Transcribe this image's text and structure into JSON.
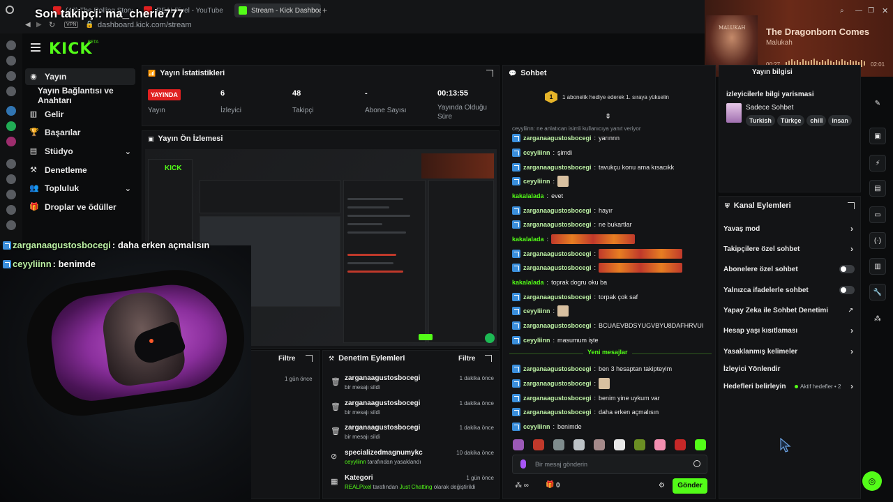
{
  "browser": {
    "tabs": [
      "(40) The Rolling Stones - ...",
      "REALPixel - YouTube",
      "Stream - Kick Dashboard"
    ],
    "url": "dashboard.kick.com/stream",
    "vpn": "VPN"
  },
  "overlay": {
    "last_follower": "Son takipçi: ma_cherie777",
    "chat1_user": "zarganaagustosbocegi",
    "chat1_text": ": daha erken açmalısın",
    "chat2_user": "ceyyliinn",
    "chat2_text": ": benimde"
  },
  "now_playing": {
    "title": "The Dragonborn Comes",
    "artist": "Malukah",
    "elapsed": "00:27",
    "remaining": "02:01",
    "art_label": "MALUKAH"
  },
  "brand": {
    "logo": "KICK",
    "beta": "BETA"
  },
  "nav": {
    "stream": "Yayın",
    "stream_key": "Yayın Bağlantısı ve Anahtarı",
    "income": "Gelir",
    "achievements": "Başarılar",
    "studio": "Stüdyo",
    "moderation": "Denetleme",
    "community": "Topluluk",
    "drops": "Droplar ve ödüller"
  },
  "stats": {
    "title": "Yayın İstatistikleri",
    "live_badge": "YAYINDA",
    "live_label": "Yayın",
    "viewers_value": "6",
    "viewers_label": "İzleyici",
    "followers_value": "48",
    "followers_label": "Takipçi",
    "subs_value": "-",
    "subs_label": "Abone Sayısı",
    "uptime_value": "00:13:55",
    "uptime_label": "Yayında Olduğu Süre"
  },
  "preview": {
    "title": "Yayın Ön İzlemesi"
  },
  "left_bottom": {
    "filter": "Filtre",
    "time": "1 gün önce"
  },
  "moderation": {
    "title": "Denetim Eylemleri",
    "filter": "Filtre",
    "rows": [
      {
        "user": "zarganaagustosbocegi",
        "desc": "bir mesajı sildi",
        "time": "1 dakika önce"
      },
      {
        "user": "zarganaagustosbocegi",
        "desc": "bir mesajı sildi",
        "time": "1 dakika önce"
      },
      {
        "user": "zarganaagustosbocegi",
        "desc": "bir mesajı sildi",
        "time": "1 dakika önce"
      },
      {
        "user": "specializedmagnumykc",
        "desc_user": "ceyyliinn",
        "desc": "tarafından yasaklandı",
        "time": "10 dakika önce"
      },
      {
        "user": "Kategori",
        "desc_user": "REALPixel",
        "desc": "tarafından",
        "desc_cat": "Just Chatting",
        "desc_end": "olarak değiştirildi",
        "time": "1 gün önce"
      }
    ]
  },
  "chat": {
    "title": "Sohbet",
    "gift_text": "1 abonelik hediye ederek 1. sıraya yükselin",
    "gift_rank": "1",
    "reply_hint": "ceyyliinn: ne anlatıcan isimli kullanıcıya yanıt veriyor",
    "messages": [
      {
        "user": "zarganaagustosbocegi",
        "text": "yarınnn"
      },
      {
        "user": "ceyyliinn",
        "text": "şimdi"
      },
      {
        "user": "zarganaagustosbocegi",
        "text": "tavukçu konu ama kısacıkk"
      },
      {
        "user": "ceyyliinn",
        "text": ""
      },
      {
        "user": "kakalalada",
        "text": "evet"
      },
      {
        "user": "zarganaagustosbocegi",
        "text": "hayır"
      },
      {
        "user": "zarganaagustosbocegi",
        "text": "ne bukartlar"
      },
      {
        "user": "kakalalada",
        "text": ""
      },
      {
        "user": "zarganaagustosbocegi",
        "text": ""
      },
      {
        "user": "zarganaagustosbocegi",
        "text": ""
      },
      {
        "user": "kakalalada",
        "text": "toprak dogru oku ba"
      },
      {
        "user": "zarganaagustosbocegi",
        "text": "torpak çok saf"
      },
      {
        "user": "ceyyliinn",
        "text": ""
      },
      {
        "user": "zarganaagustosbocegi",
        "text": "BCUAEVBDSYUGVBYU8DAFHRVUI"
      },
      {
        "user": "ceyyliinn",
        "text": "masumum işte"
      }
    ],
    "new_messages": "Yeni mesajlar",
    "new": [
      {
        "user": "zarganaagustosbocegi",
        "text": "ben 3 hesaptan takipteyim"
      },
      {
        "user": "zarganaagustosbocegi",
        "text": ""
      },
      {
        "user": "zarganaagustosbocegi",
        "text": "benim yine uykum var"
      },
      {
        "user": "zarganaagustosbocegi",
        "text": "daha erken açmalısın"
      },
      {
        "user": "ceyyliinn",
        "text": "benimde"
      }
    ],
    "input_placeholder": "Bir mesaj gönderin",
    "send": "Gönder",
    "count": "0"
  },
  "stream_info": {
    "title": "Yayın bilgisi",
    "stream_title": "izleyicilerle bilgi yarismasi",
    "category": "Sadece Sohbet",
    "tags": [
      "Turkish",
      "Türkçe",
      "chill",
      "insan"
    ]
  },
  "channel_actions": {
    "title": "Kanal Eylemleri",
    "slow_mode": "Yavaş mod",
    "followers_only": "Takipçilere özel sohbet",
    "subs_only": "Abonelere özel sohbet",
    "emotes_only": "Yalnızca ifadelerle sohbet",
    "ai_moderation": "Yapay Zeka ile Sohbet Denetimi",
    "account_age": "Hesap yaşı kısıtlaması",
    "banned_words": "Yasaklanmış kelimeler",
    "raid": "İzleyici Yönlendir",
    "goals": "Hedefleri belirleyin",
    "goals_status": "Aktif hedefler • 2"
  },
  "colors": {
    "accent": "#53fc18",
    "live": "#e02020",
    "panel": "#131416"
  }
}
